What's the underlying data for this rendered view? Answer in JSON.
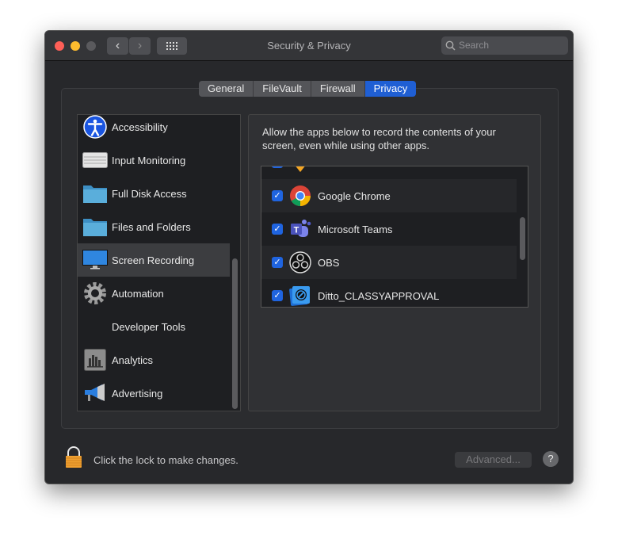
{
  "window": {
    "title": "Security & Privacy",
    "search_placeholder": "Search"
  },
  "tabs": [
    {
      "label": "General"
    },
    {
      "label": "FileVault"
    },
    {
      "label": "Firewall"
    },
    {
      "label": "Privacy",
      "active": true
    }
  ],
  "sidebar": {
    "items": [
      {
        "label": "Accessibility",
        "icon": "accessibility-icon"
      },
      {
        "label": "Input Monitoring",
        "icon": "keyboard-icon"
      },
      {
        "label": "Full Disk Access",
        "icon": "folder-icon"
      },
      {
        "label": "Files and Folders",
        "icon": "folder-icon"
      },
      {
        "label": "Screen Recording",
        "icon": "display-icon",
        "selected": true
      },
      {
        "label": "Automation",
        "icon": "gear-icon"
      },
      {
        "label": "Developer Tools",
        "icon": ""
      },
      {
        "label": "Analytics",
        "icon": "analytics-icon"
      },
      {
        "label": "Advertising",
        "icon": "megaphone-icon"
      }
    ]
  },
  "main": {
    "description": "Allow the apps below to record the contents of your screen, even while using other apps.",
    "apps": [
      {
        "name": "Google Chrome",
        "checked": true
      },
      {
        "name": "Microsoft Teams",
        "checked": true
      },
      {
        "name": "OBS",
        "checked": true
      },
      {
        "name": "Ditto_CLASSYAPPROVAL",
        "checked": true
      }
    ]
  },
  "footer": {
    "lock_text": "Click the lock to make changes.",
    "advanced_label": "Advanced...",
    "help_label": "?"
  },
  "colors": {
    "accent": "#1f5fd4",
    "close": "#fe5f57",
    "minimize": "#febc2e",
    "zoom": "#5a5a5d"
  }
}
